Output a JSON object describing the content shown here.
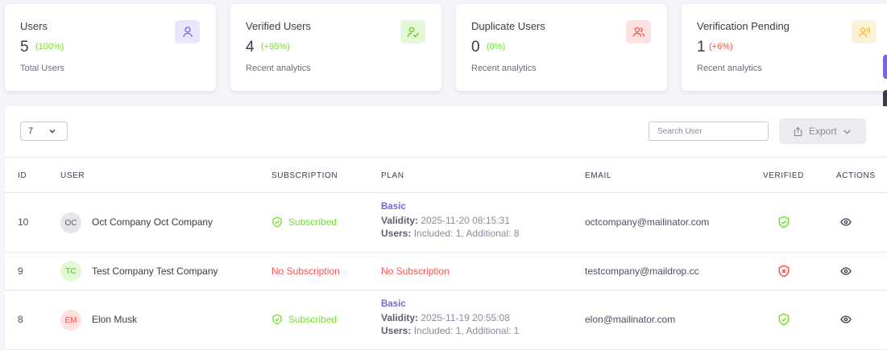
{
  "stats": [
    {
      "title": "Users",
      "number": "5",
      "change": "(100%)",
      "change_color": "#72e128",
      "subtitle": "Total Users",
      "icon": "user-icon",
      "icon_bg": "#e8e7fd",
      "icon_color": "#7367f0"
    },
    {
      "title": "Verified Users",
      "number": "4",
      "change": "(+95%)",
      "change_color": "#72e128",
      "subtitle": "Recent analytics",
      "icon": "user-check-icon",
      "icon_bg": "#e2f8d6",
      "icon_color": "#56ca00"
    },
    {
      "title": "Duplicate Users",
      "number": "0",
      "change": "(0%)",
      "change_color": "#72e128",
      "subtitle": "Recent analytics",
      "icon": "users-icon",
      "icon_bg": "#ffe1e0",
      "icon_color": "#ff4d49"
    },
    {
      "title": "Verification Pending",
      "number": "1",
      "change": "(+6%)",
      "change_color": "#ff4d49",
      "subtitle": "Recent analytics",
      "icon": "user-voice-icon",
      "icon_bg": "#fff1d6",
      "icon_color": "#fdb528"
    }
  ],
  "toolbar": {
    "page_size": "7",
    "search_placeholder": "Search User",
    "export_label": "Export"
  },
  "columns": [
    "ID",
    "USER",
    "SUBSCRIPTION",
    "PLAN",
    "EMAIL",
    "VERIFIED",
    "ACTIONS"
  ],
  "rows": [
    {
      "id": "10",
      "initials": "OC",
      "name": "Oct Company Oct Company",
      "subscription": "Subscribed",
      "subscribed": true,
      "plan": {
        "name": "Basic",
        "validity_label": "Validity:",
        "validity": "2025-11-20 08:15:31",
        "users_label": "Users:",
        "users": "Included: 1, Additional: 8"
      },
      "email": "octcompany@mailinator.com",
      "verified": true
    },
    {
      "id": "9",
      "initials": "TC",
      "name": "Test Company Test Company",
      "subscription": "No Subscription",
      "subscribed": false,
      "plan_text": "No Subscription",
      "email": "testcompany@maildrop.cc",
      "verified": false
    },
    {
      "id": "8",
      "initials": "EM",
      "name": "Elon Musk",
      "subscription": "Subscribed",
      "subscribed": true,
      "plan": {
        "name": "Basic",
        "validity_label": "Validity:",
        "validity": "2025-11-19 20:55:08",
        "users_label": "Users:",
        "users": "Included: 1, Additional: 1"
      },
      "email": "elon@mailinator.com",
      "verified": true
    }
  ],
  "colors": {
    "primary": "#7367f0",
    "success": "#72e128",
    "error": "#ff4d49",
    "warning": "#fdb528"
  }
}
